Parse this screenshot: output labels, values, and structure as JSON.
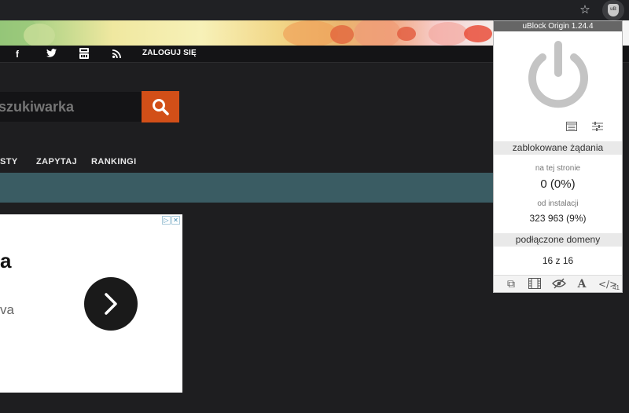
{
  "browser": {
    "star_icon": "star-icon",
    "extension_icon_text": "uB"
  },
  "site": {
    "social_icons": [
      "facebook-icon",
      "twitter-icon",
      "youtube-icon",
      "rss-icon"
    ],
    "login_label": "ZALOGUJ SIĘ",
    "search_placeholder": "szukiwarka",
    "menu": [
      "STY",
      "ZAPYTAJ",
      "RANKINGI"
    ],
    "ad": {
      "heading": "a",
      "sub": "va"
    }
  },
  "ubo": {
    "title": "uBlock Origin 1.24.4",
    "blocked_header": "zablokowane żądania",
    "on_page_label": "na tej stronie",
    "on_page_value": "0 (0%)",
    "since_install_label": "od instalacji",
    "since_install_value": "323 963 (9%)",
    "domains_header": "podłączone domeny",
    "domains_value": "16 z 16",
    "bottom_count": "41"
  }
}
